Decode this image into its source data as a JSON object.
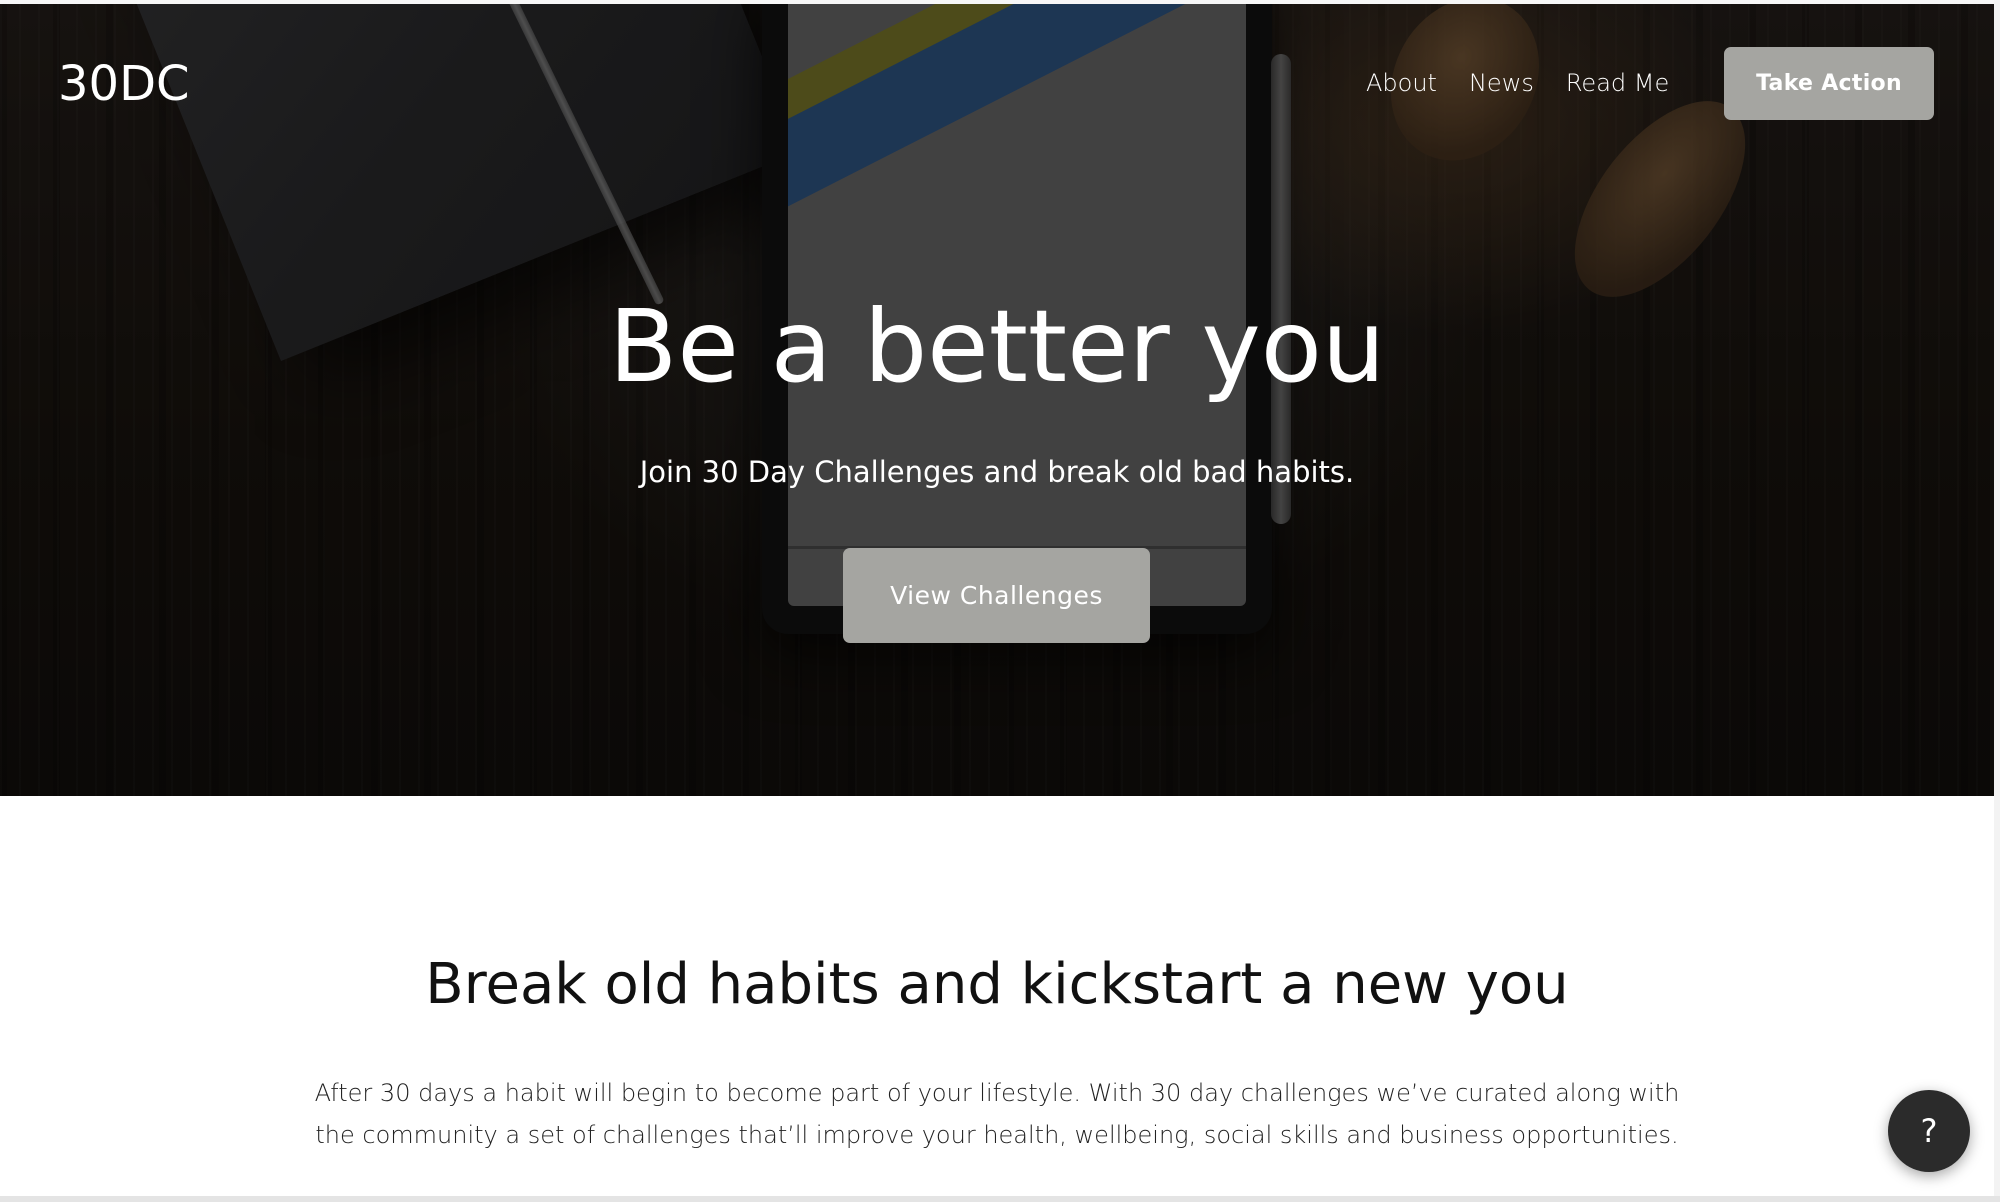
{
  "brand": {
    "logo_text": "30DC"
  },
  "nav": {
    "links": [
      {
        "label": "About"
      },
      {
        "label": "News"
      },
      {
        "label": "Read Me"
      }
    ],
    "cta_label": "Take Action"
  },
  "hero": {
    "title": "Be a better you",
    "subtitle": "Join 30 Day Challenges and break old bad habits.",
    "cta_label": "View Challenges"
  },
  "section": {
    "title": "Break old habits and kickstart a new you",
    "body_lines": [
      "After 30 days a habit will begin to become part of your lifestyle. With 30 day challenges we’ve curated along with",
      "the community a set of challenges that’ll improve your health, wellbeing, social skills and business opportunities."
    ]
  },
  "help": {
    "label": "?"
  },
  "colors": {
    "button_gray": "#a5a5a1",
    "help_button": "#2b2b2b",
    "text_dark": "#111111"
  },
  "icons": {
    "help": "question-mark-icon"
  }
}
